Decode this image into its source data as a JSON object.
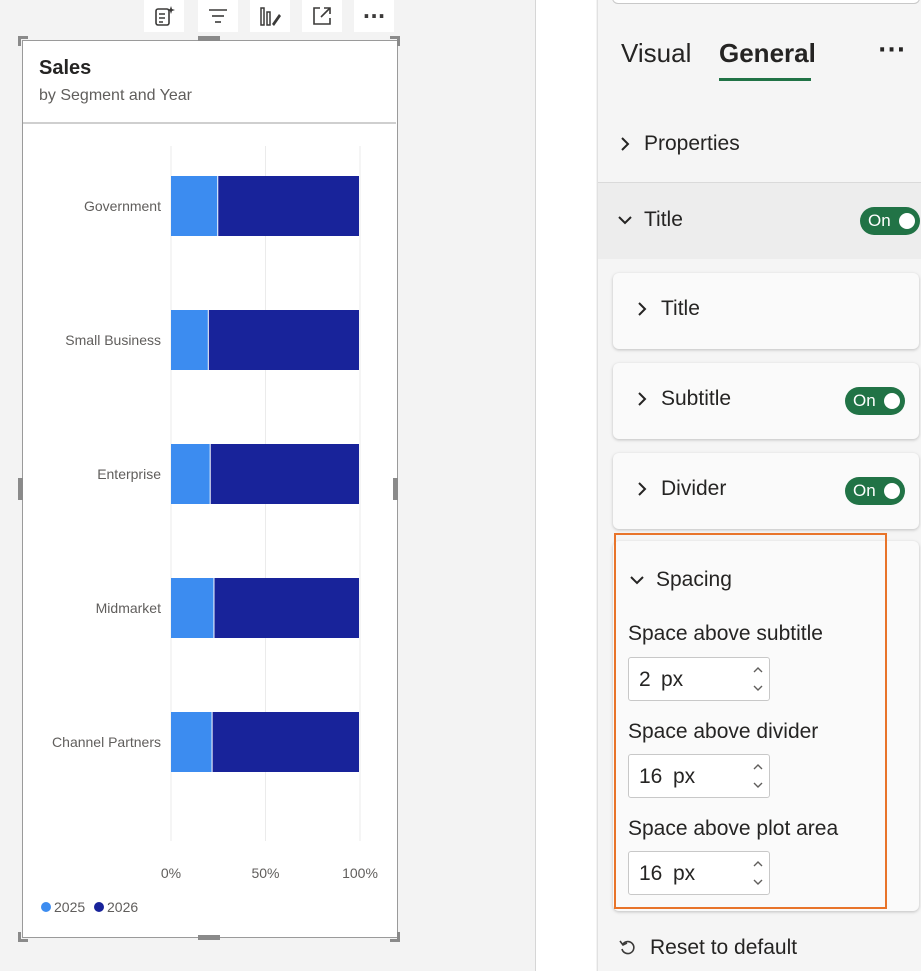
{
  "visual": {
    "title": "Sales",
    "subtitle": "by Segment and Year"
  },
  "toolbar": {
    "icons": [
      "copilot-summary-icon",
      "filter-icon",
      "format-visual-icon",
      "focus-mode-icon",
      "more-options-icon"
    ],
    "more_label": "···"
  },
  "chart_data": {
    "type": "bar",
    "orientation": "horizontal",
    "stacked": "100%",
    "title": "Sales",
    "subtitle": "by Segment and Year",
    "categories": [
      "Government",
      "Small Business",
      "Enterprise",
      "Midmarket",
      "Channel Partners"
    ],
    "series": [
      {
        "name": "2025",
        "values": [
          25,
          20,
          21,
          23,
          22
        ],
        "color": "#3c8cf0"
      },
      {
        "name": "2026",
        "values": [
          75,
          80,
          79,
          77,
          78
        ],
        "color": "#18239a"
      }
    ],
    "xlim": [
      0,
      100
    ],
    "x_ticks": [
      "0%",
      "50%",
      "100%"
    ],
    "grid": true,
    "legend_position": "bottom-left"
  },
  "pane": {
    "tabs": [
      {
        "label": "Visual",
        "active": false
      },
      {
        "label": "General",
        "active": true
      }
    ],
    "more_label": "···",
    "accent": "#217346",
    "properties_label": "Properties",
    "title_section": {
      "label": "Title",
      "toggle": "On"
    },
    "cards": {
      "title": {
        "label": "Title"
      },
      "subtitle": {
        "label": "Subtitle",
        "toggle": "On"
      },
      "divider": {
        "label": "Divider",
        "toggle": "On"
      }
    },
    "spacing": {
      "label": "Spacing",
      "highlight_color": "#e8742a",
      "fields": [
        {
          "label": "Space above subtitle",
          "value": "2",
          "unit": "px"
        },
        {
          "label": "Space above divider",
          "value": "16",
          "unit": "px"
        },
        {
          "label": "Space above plot area",
          "value": "16",
          "unit": "px"
        }
      ]
    },
    "reset_label": "Reset to default"
  }
}
